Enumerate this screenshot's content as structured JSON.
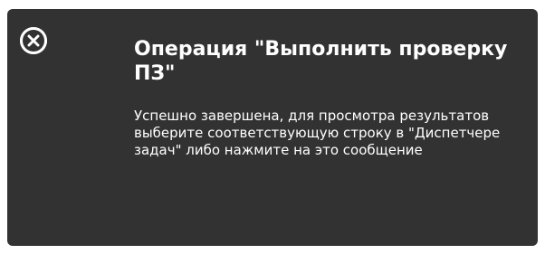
{
  "notification": {
    "close_icon": "close-circle-icon",
    "title": "Операция \"Выполнить проверку ПЗ\"",
    "message": "Успешно завершена, для просмотра результатов выберите соответствующую строку в \"Диспетчере задач\" либо нажмите на это сообщение",
    "colors": {
      "background": "#323232",
      "text": "#ffffff",
      "close_icon_bg": "#ffffff",
      "close_icon_fg": "#323232"
    }
  }
}
